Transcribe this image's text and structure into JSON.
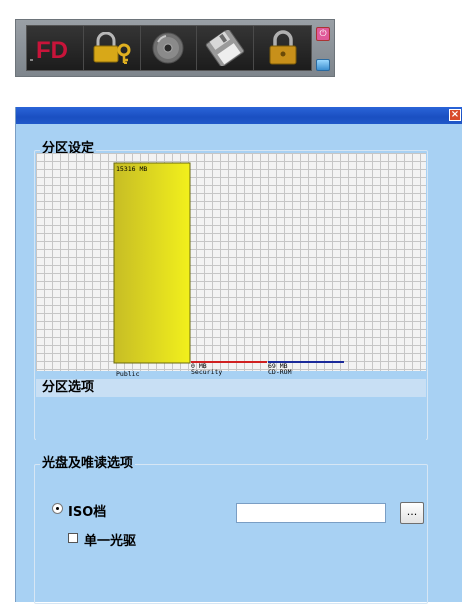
{
  "toolbar": {
    "buttons": [
      {
        "name": "partition-logo-button",
        "label": "FD",
        "icon": "partition-icon"
      },
      {
        "name": "lock-key-button",
        "icon": "lock-key-icon"
      },
      {
        "name": "cd-button",
        "icon": "cd-icon"
      },
      {
        "name": "floppy-button",
        "icon": "floppy-disk-icon"
      },
      {
        "name": "padlock-button",
        "icon": "padlock-icon"
      }
    ],
    "side_top_glyph": "⏻"
  },
  "dialog": {
    "close_label": "×"
  },
  "partition_group": {
    "title": "分区设定"
  },
  "chart_data": {
    "type": "bar",
    "categories": [
      "Public",
      "Security",
      "CD-ROM"
    ],
    "values": [
      15316,
      0,
      69
    ],
    "units": "MB",
    "data_labels": [
      "15316 MB",
      "0 MB",
      "69 MB"
    ],
    "colors": [
      "#e6e61c",
      "#d02020",
      "#1a2a9a"
    ],
    "grid": true
  },
  "options_group": {
    "title": "分区选项"
  },
  "cd_group": {
    "title": "光盘及唯读选项",
    "iso_label": "ISO档",
    "iso_value": "",
    "browse_label": "...",
    "single_drive_label": "单一光驱"
  }
}
